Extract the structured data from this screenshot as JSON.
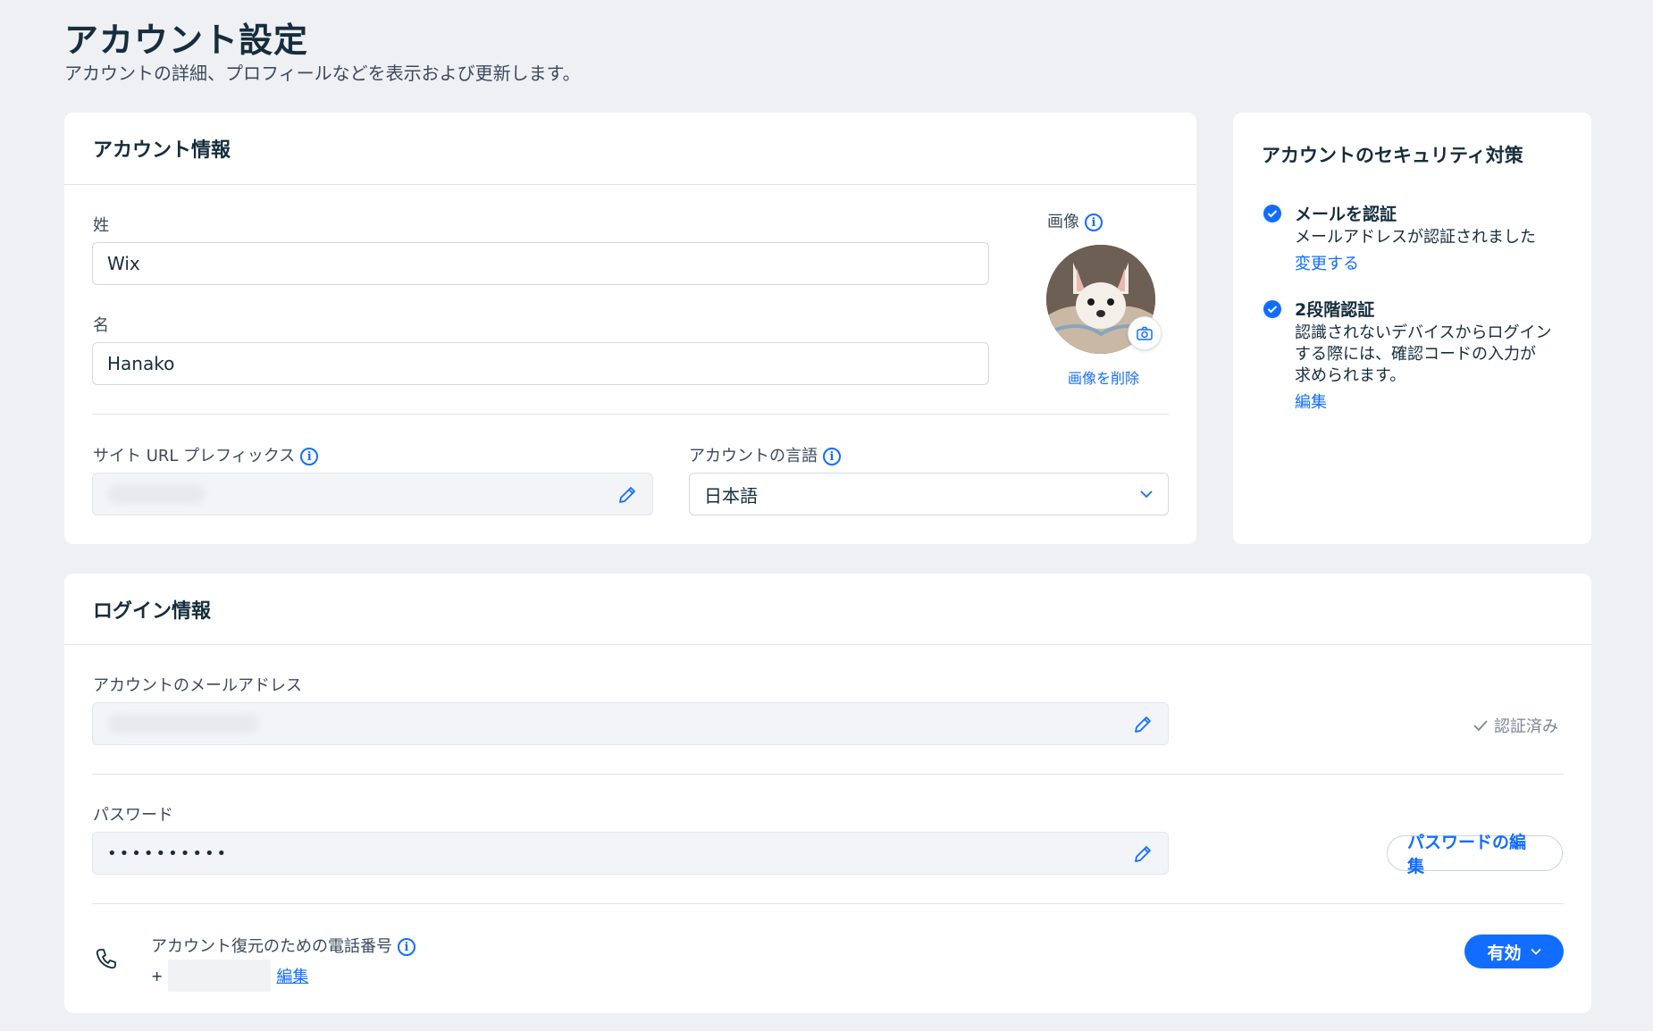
{
  "header": {
    "title": "アカウント設定",
    "subtitle": "アカウントの詳細、プロフィールなどを表示および更新します。"
  },
  "account_info": {
    "title": "アカウント情報",
    "last_name_label": "姓",
    "last_name_value": "Wix",
    "first_name_label": "名",
    "first_name_value": "Hanako",
    "image_label": "画像",
    "remove_image": "画像を削除",
    "url_prefix_label": "サイト URL プレフィックス",
    "language_label": "アカウントの言語",
    "language_value": "日本語"
  },
  "security": {
    "title": "アカウントのセキュリティ対策",
    "items": [
      {
        "title": "メールを認証",
        "lines": [
          "メールアドレスが認証されました"
        ],
        "link": "変更する"
      },
      {
        "title": "2段階認証",
        "lines": [
          "認識されないデバイスからログイン",
          "する際には、確認コードの入力が",
          "求められます。"
        ],
        "link": "編集"
      }
    ]
  },
  "login_info": {
    "title": "ログイン情報",
    "email_label": "アカウントのメールアドレス",
    "verified_label": "認証済み",
    "password_label": "パスワード",
    "password_value": "••••••••••",
    "edit_password_button": "パスワードの編集",
    "phone_label": "アカウント復元のための電話番号",
    "phone_prefix": "+",
    "phone_edit_link": "編集",
    "status_button": "有効"
  },
  "colors": {
    "accent": "#116dff",
    "background": "#eef0f4",
    "text": "#162d3d"
  }
}
